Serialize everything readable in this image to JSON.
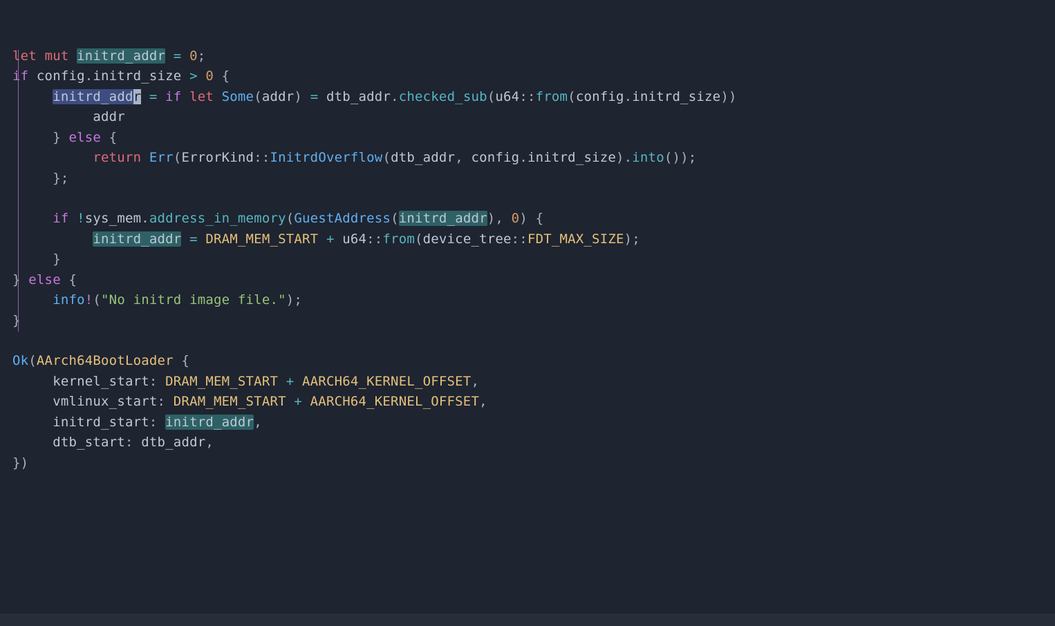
{
  "code": {
    "l1": {
      "let": "let",
      "mut": "mut",
      "var": "initrd_addr",
      "eq": "=",
      "zero": "0",
      "semi": ";"
    },
    "l2": {
      "if": "if",
      "cfg": "config",
      "dot": ".",
      "field": "initrd_size",
      "gt": ">",
      "zero": "0",
      "brace": "{"
    },
    "l3": {
      "var": "initrd_add",
      "varcur": "r",
      "eq": "=",
      "if": "if",
      "let": "let",
      "some": "Some",
      "addr": "addr",
      "dtb": "dtb_addr",
      "dot": ".",
      "sub": "checked_sub",
      "u64": "u64",
      "cc": "::",
      "from": "from",
      "cfg": "config",
      "dot2": ".",
      "field": "initrd_size"
    },
    "l4": {
      "addr": "addr"
    },
    "l5": {
      "close": "}",
      "else": "else",
      "open": "{"
    },
    "l6": {
      "return": "return",
      "err": "Err",
      "ek": "ErrorKind",
      "cc": "::",
      "variant": "InitrdOverflow",
      "dtb": "dtb_addr",
      "cfg": "config",
      "dot": ".",
      "field": "initrd_size",
      "into": "into",
      "semi": ";"
    },
    "l7": {
      "close": "};"
    },
    "l9": {
      "if": "if",
      "bang": "!",
      "sm": "sys_mem",
      "dot": ".",
      "aim": "address_in_memory",
      "ga": "GuestAddress",
      "var": "initrd_addr",
      "zero": "0",
      "brace": "{"
    },
    "l10": {
      "var": "initrd_addr",
      "eq": "=",
      "dms": "DRAM_MEM_START",
      "plus": "+",
      "u64": "u64",
      "cc": "::",
      "from": "from",
      "dt": "device_tree",
      "cc2": "::",
      "fms": "FDT_MAX_SIZE",
      "semi": ";"
    },
    "l11": {
      "close": "}"
    },
    "l12": {
      "close": "}",
      "else": "else",
      "open": "{"
    },
    "l13": {
      "info": "info",
      "bang": "!",
      "str": "\"No initrd image file.\"",
      "semi": ";"
    },
    "l14": {
      "close": "}"
    },
    "l16": {
      "ok": "Ok",
      "ty": "AArch64BootLoader",
      "brace": "{"
    },
    "l17": {
      "field": "kernel_start",
      "colon": ":",
      "dms": "DRAM_MEM_START",
      "plus": "+",
      "ako": "AARCH64_KERNEL_OFFSET",
      "comma": ","
    },
    "l18": {
      "field": "vmlinux_start",
      "colon": ":",
      "dms": "DRAM_MEM_START",
      "plus": "+",
      "ako": "AARCH64_KERNEL_OFFSET",
      "comma": ","
    },
    "l19": {
      "field": "initrd_start",
      "colon": ":",
      "var": "initrd_addr",
      "comma": ","
    },
    "l20": {
      "field": "dtb_start",
      "colon": ":",
      "var": "dtb_addr",
      "comma": ","
    },
    "l21": {
      "close": "})"
    }
  }
}
